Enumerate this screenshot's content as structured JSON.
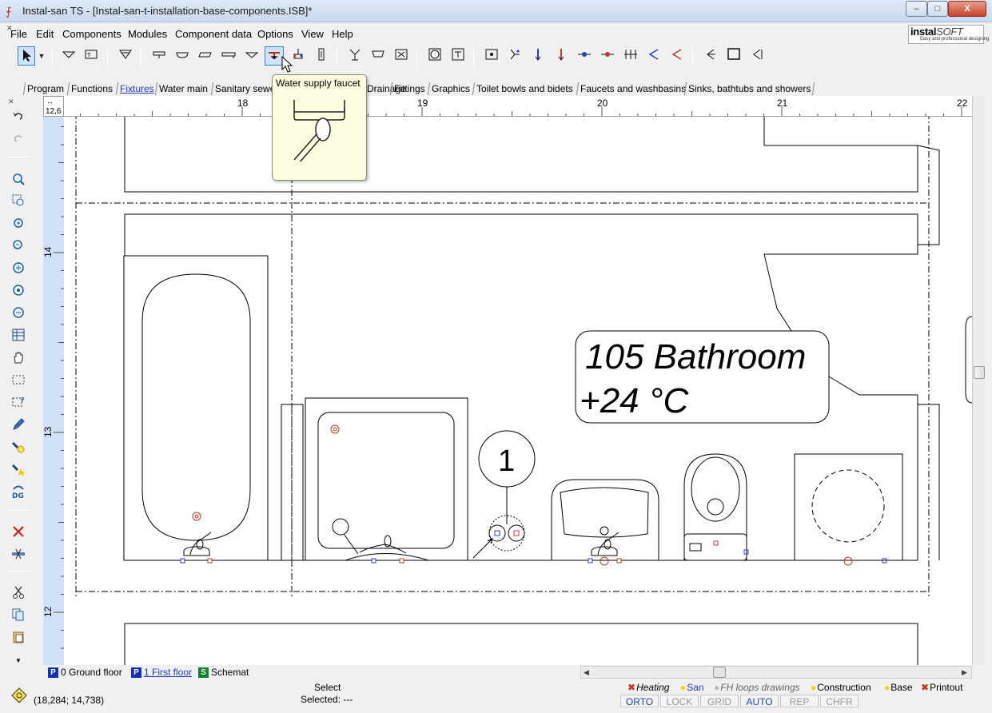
{
  "window": {
    "title": "Instal-san TS - [Instal-san-t-installation-base-components.ISB]*",
    "minimize": "–",
    "maximize": "□",
    "close": "X"
  },
  "menu": [
    "File",
    "Edit",
    "Components",
    "Modules",
    "Component data",
    "Options",
    "View",
    "Help"
  ],
  "logo": {
    "brand": "instal",
    "brand_suffix": "SOFT",
    "tagline": "Easy and professional designing"
  },
  "toolbar": {
    "active_tool": "Water supply faucet"
  },
  "component_tabs": [
    "Program",
    "Functions",
    "Fixtures",
    "Water main",
    "Sanitary sewer",
    "Drainage",
    "Fittings",
    "Graphics",
    "Toilet bowls and bidets",
    "Faucets and washbasins",
    "Sinks, bathtubs and showers"
  ],
  "component_tabs_selected": "Fixtures",
  "tooltip": {
    "title": "Water supply faucet"
  },
  "ruler": {
    "corner_value": "12,6",
    "top_labels": [
      "18",
      "19",
      "20",
      "21",
      "22"
    ],
    "left_labels": [
      "14",
      "13",
      "12"
    ]
  },
  "drawing": {
    "room_name": "105 Bathroom",
    "room_temp": "+24 °C",
    "riser_number": "1"
  },
  "floor_tabs": [
    {
      "badge": "P",
      "label": "0 Ground floor",
      "color": "blue"
    },
    {
      "badge": "P",
      "label": "1 First floor",
      "color": "blue"
    },
    {
      "badge": "S",
      "label": "Schemat",
      "color": "green"
    }
  ],
  "floor_tabs_current": "1 First floor",
  "status": {
    "coords": "(18,284; 14,738)",
    "mode": "Select",
    "selected": "Selected: ---"
  },
  "layers": [
    {
      "icon": "✖",
      "label": "Heating",
      "on": false
    },
    {
      "icon": "●",
      "label": "San",
      "on": true
    },
    {
      "icon": "●",
      "label": "FH loops drawings",
      "on": false
    },
    {
      "icon": "●",
      "label": "Construction",
      "on": true
    },
    {
      "icon": "●",
      "label": "Base",
      "on": true
    },
    {
      "icon": "✖",
      "label": "Printout",
      "on": true
    }
  ],
  "modes": [
    {
      "label": "ORTO",
      "on": true
    },
    {
      "label": "LOCK",
      "on": false
    },
    {
      "label": "GRID",
      "on": false
    },
    {
      "label": "AUTO",
      "on": true
    },
    {
      "label": "REP",
      "on": false
    },
    {
      "label": "CHFR",
      "on": false
    }
  ],
  "colors": {
    "ruler_blue": "#cfe0f7",
    "tooltip_bg": "#fefde0",
    "link_blue": "#1f3fbf",
    "fixture_red": "#c0392b",
    "fixture_blue": "#2040c0"
  }
}
